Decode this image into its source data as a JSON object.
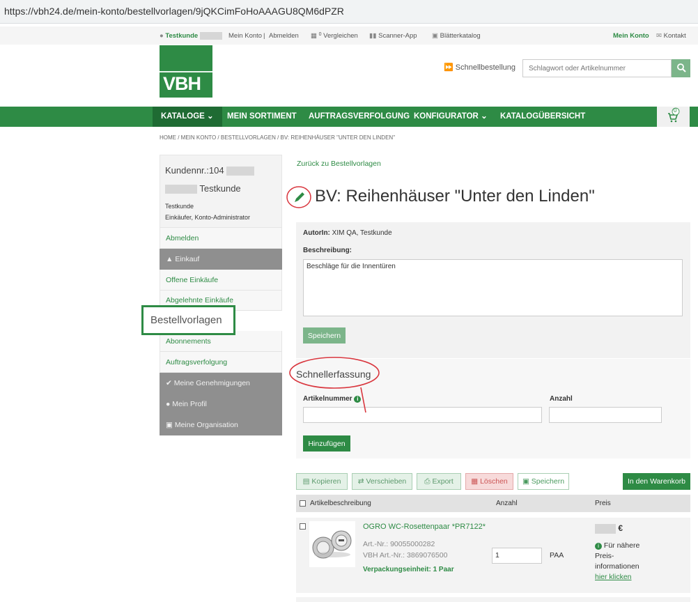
{
  "browser": {
    "url": "https://vbh24.de/mein-konto/bestellvorlagen/9jQKCimFoHoAAAGU8QM6dPZR"
  },
  "topbar": {
    "user": "Testkunde",
    "account": "Mein Konto",
    "sep": "|",
    "logout": "Abmelden",
    "compare": "Vergleichen",
    "compare_count": "0",
    "scanner": "Scanner-App",
    "catalog": "Blätterkatalog",
    "my_account": "Mein Konto",
    "contact": "Kontakt"
  },
  "header": {
    "logo_text": "VBH",
    "quick_order": "Schnellbestellung",
    "search_placeholder": "Schlagwort oder Artikelnummer"
  },
  "nav": {
    "items": [
      "KATALOGE",
      "MEIN SORTIMENT",
      "AUFTRAGSVERFOLGUNG",
      "KONFIGURATOR",
      "KATALOGÜBERSICHT"
    ],
    "cart_count": "0"
  },
  "breadcrumb": "HOME  /  MEIN KONTO  /  BESTELLVORLAGEN  /  BV: REIHENHÄUSER \"UNTER DEN LINDEN\"",
  "sidebar": {
    "customer_no": "Kundennr.:104",
    "customer_name": "Testkunde",
    "user_name": "Testkunde",
    "roles": "Einkäufer, Konto-Administrator",
    "items": [
      "Abmelden",
      "Einkauf",
      "Offene Einkäufe",
      "Abgelehnte Einkäufe",
      "Bestellvorlagen",
      "Abonnements",
      "Auftragsverfolgung",
      "Meine Genehmigungen",
      "Mein Profil",
      "Meine Organisation"
    ]
  },
  "main": {
    "back_link": "Zurück zu Bestellvorlagen",
    "title": "BV: Reihenhäuser \"Unter den Linden\"",
    "author_label": "AutorIn:",
    "author_value": "XIM QA, Testkunde",
    "description_label": "Beschreibung:",
    "description_value": "Beschläge für die Innentüren",
    "save_button": "Speichern",
    "quick_entry_title": "Schnellerfassung",
    "article_no_label": "Artikelnummer",
    "quantity_label": "Anzahl",
    "add_button": "Hinzufügen"
  },
  "actions": {
    "copy": "Kopieren",
    "move": "Verschieben",
    "export": "Export",
    "delete": "Löschen",
    "save": "Speichern",
    "to_cart": "In den Warenkorb"
  },
  "table": {
    "headers": [
      "Artikelbeschreibung",
      "Anzahl",
      "Preis"
    ],
    "rows": [
      {
        "name": "OGRO WC-Rosettenpaar *PR7122*",
        "art_no": "Art.-Nr.: 90055000282",
        "vbh_art_no": "VBH Art.-Nr.: 3869076500",
        "packaging": "Verpackungseinheit: 1 Paar",
        "quantity": "1",
        "unit": "PAA",
        "currency": "€",
        "price_info_1": "Für nähere",
        "price_info_2": "Preis-",
        "price_info_3": "informationen",
        "price_link": "hier klicken"
      }
    ]
  },
  "colors": {
    "brand_green": "#2e8b45",
    "annotation_red": "#d9363e"
  }
}
